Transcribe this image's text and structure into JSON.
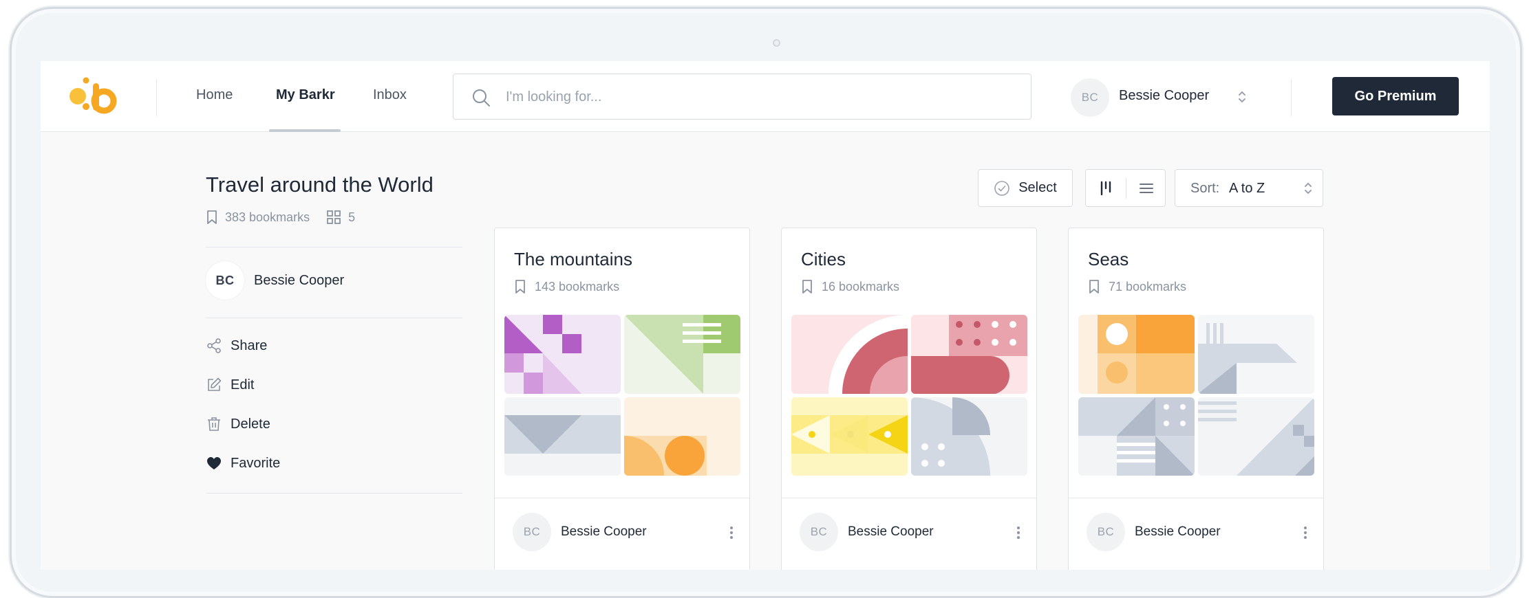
{
  "header": {
    "nav": [
      {
        "label": "Home"
      },
      {
        "label": "My Barkr"
      },
      {
        "label": "Inbox"
      }
    ],
    "search": {
      "placeholder": "I'm looking for..."
    },
    "user": {
      "initials": "BC",
      "name": "Bessie Cooper"
    },
    "premium_label": "Go Premium"
  },
  "collection": {
    "title": "Travel around the World",
    "bookmarks": "383 bookmarks",
    "groups": "5",
    "owner": {
      "initials": "BC",
      "name": "Bessie Cooper"
    },
    "actions": [
      {
        "label": "Share"
      },
      {
        "label": "Edit"
      },
      {
        "label": "Delete"
      },
      {
        "label": "Favorite"
      }
    ]
  },
  "toolbar": {
    "select_label": "Select",
    "sort_label": "Sort:",
    "sort_value": "A to Z"
  },
  "cards": [
    {
      "title": "The mountains",
      "count": "143 bookmarks",
      "owner_initials": "BC",
      "owner": "Bessie Cooper"
    },
    {
      "title": "Cities",
      "count": "16 bookmarks",
      "owner_initials": "BC",
      "owner": "Bessie Cooper"
    },
    {
      "title": "Seas",
      "count": "71 bookmarks",
      "owner_initials": "BC",
      "owner": "Bessie Cooper"
    }
  ],
  "colors": {
    "brand": "#f7a823",
    "dark": "#1f2937",
    "muted": "#8a93a0"
  }
}
